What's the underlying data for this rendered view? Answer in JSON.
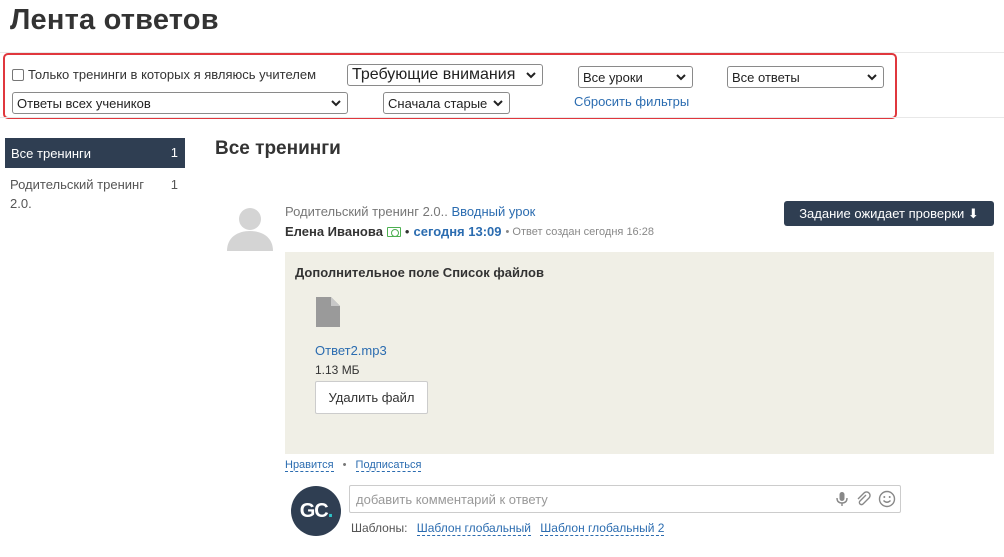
{
  "page": {
    "title": "Лента ответов"
  },
  "filters": {
    "only_teacher_checkbox_label": "Только тренинги в которых я являюсь учителем",
    "status_select": "Требующие внимания",
    "lessons_select": "Все уроки",
    "answers_select": "Все ответы",
    "students_select": "Ответы всех учеников",
    "order_select": "Сначала старые",
    "reset_link": "Сбросить фильтры"
  },
  "sidebar": {
    "items": [
      {
        "label": "Все тренинги",
        "count": "1"
      },
      {
        "label": "Родительский тренинг 2.0.",
        "count": "1"
      }
    ]
  },
  "main": {
    "section_title": "Все тренинги",
    "answer": {
      "training": "Родительский тренинг 2.0..",
      "lesson_link": "Вводный урок",
      "author": "Елена Иванова",
      "separator": "•",
      "time": "сегодня 13:09",
      "created": "• Ответ создан сегодня 16:28",
      "status_button": "Задание ожидает проверки ⬇",
      "field_title": "Дополнительное поле Список файлов",
      "file_name": "Ответ2.mp3",
      "file_size": "1.13 МБ",
      "delete_button": "Удалить файл",
      "like_link": "Нравится",
      "action_dot": "•",
      "subscribe_link": "Подписаться"
    },
    "comment": {
      "avatar_text": "GC",
      "avatar_dot": ".",
      "placeholder": "добавить комментарий к ответу",
      "templates_label": "Шаблоны:",
      "templates": [
        "Шаблон глобальный",
        "Шаблон глобальный 2"
      ]
    }
  },
  "colors": {
    "accent_dark": "#2f3e52",
    "link": "#2b6cb0",
    "filter_border": "#e0373d",
    "answer_bg": "#f0efe6"
  },
  "icons": [
    "chevron-down-icon",
    "user-avatar-icon",
    "file-icon",
    "cash-icon",
    "microphone-icon",
    "paperclip-icon",
    "smile-icon"
  ]
}
